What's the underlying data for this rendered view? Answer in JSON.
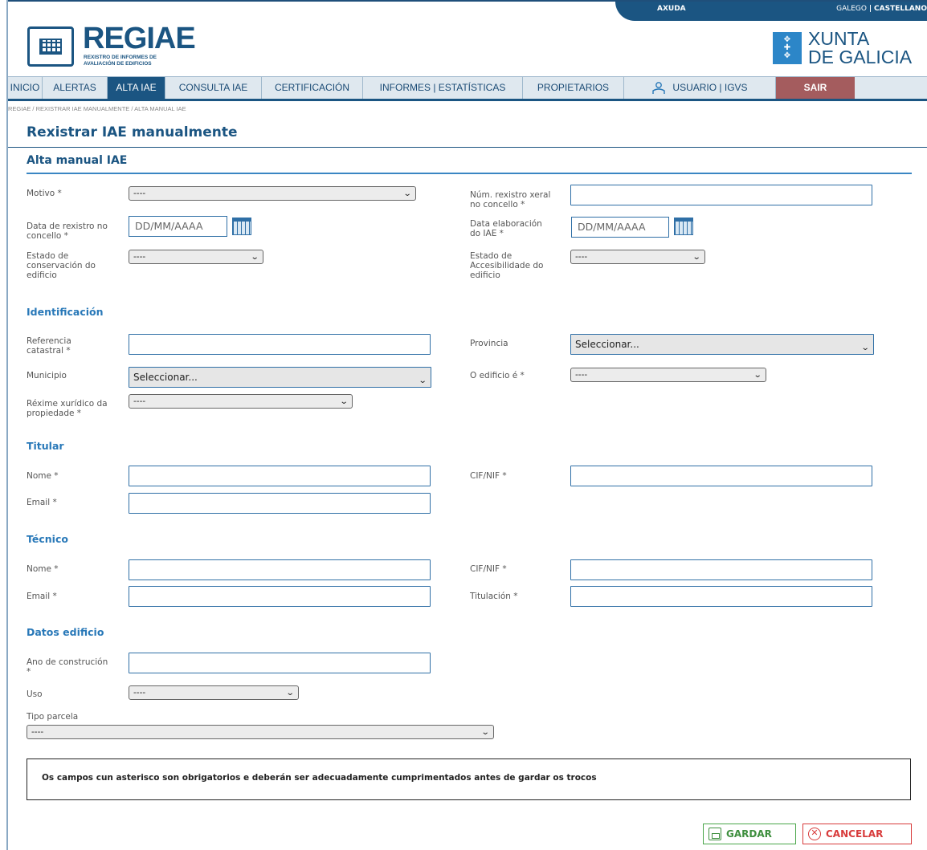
{
  "utility": {
    "help": "AXUDA",
    "lang_gl": "GALEGO",
    "separator": "|",
    "lang_es": "CASTELLANO"
  },
  "brand": {
    "app_title": "REGIAE",
    "app_subtitle_1": "REXISTRO DE INFORMES DE",
    "app_subtitle_2": "AVALIACIÓN DE EDIFICIOS",
    "gov_line1": "XUNTA",
    "gov_line2": "DE GALICIA"
  },
  "nav": {
    "items": [
      "INICIO",
      "ALERTAS",
      "ALTA IAE",
      "CONSULTA IAE",
      "CERTIFICACIÓN",
      "INFORMES | ESTATÍSTICAS",
      "PROPIETARIOS",
      "USUARIO | IGVS",
      "SAIR"
    ],
    "active": "ALTA IAE"
  },
  "breadcrumb": "REGIAE / REXISTRAR IAE MANUALMENTE / ALTA MANUAL IAE",
  "page_title": "Rexistrar IAE manualmente",
  "section_title": "Alta manual IAE",
  "general": {
    "motivo_label": "Motivo *",
    "motivo_value": "----",
    "num_rexistro_label_1": "Núm. rexistro xeral",
    "num_rexistro_label_2": "no concello *",
    "data_rexistro_label_1": "Data de rexistro no",
    "data_rexistro_label_2": "concello *",
    "data_rexistro_placeholder": "DD/MM/AAAA",
    "data_elab_label_1": "Data elaboración",
    "data_elab_label_2": "do IAE *",
    "data_elab_placeholder": "DD/MM/AAAA",
    "estado_cons_label_1": "Estado de",
    "estado_cons_label_2": "conservación do",
    "estado_cons_label_3": "edificio",
    "estado_cons_value": "----",
    "estado_acc_label_1": "Estado de",
    "estado_acc_label_2": "Accesibilidade do",
    "estado_acc_label_3": "edificio",
    "estado_acc_value": "----"
  },
  "identificacion": {
    "title": "Identificación",
    "ref_label_1": "Referencia",
    "ref_label_2": "catastral *",
    "provincia_label": "Provincia",
    "provincia_value": "Seleccionar...",
    "municipio_label": "Municipio",
    "municipio_value": "Seleccionar...",
    "edificio_label": "O edificio é *",
    "edificio_value": "----",
    "rexime_label_1": "Réxime xurídico da",
    "rexime_label_2": "propiedade *",
    "rexime_value": "----"
  },
  "titular": {
    "title": "Titular",
    "nome_label": "Nome *",
    "cif_label": "CIF/NIF *",
    "email_label": "Email *"
  },
  "tecnico": {
    "title": "Técnico",
    "nome_label": "Nome *",
    "cif_label": "CIF/NIF *",
    "email_label": "Email *",
    "titulacion_label": "Titulación *"
  },
  "edificio": {
    "title": "Datos edificio",
    "ano_label_1": "Ano de construción",
    "ano_label_2": "*",
    "uso_label": "Uso",
    "uso_value": "----",
    "parcela_label": "Tipo parcela",
    "parcela_value": "----"
  },
  "notice": "Os campos cun asterisco son obrigatorios e deberán ser adecuadamente cumprimentados antes de gardar os trocos",
  "actions": {
    "save": "GARDAR",
    "cancel": "CANCELAR"
  },
  "colors": {
    "primary": "#1b5582",
    "accent": "#2878b8",
    "exit": "#a45c5e",
    "save": "#3e8f3e",
    "cancel": "#d83b3b"
  },
  "icons": {
    "logo": "grid-logo-icon",
    "gov": "xunta-emblem-icon",
    "user": "user-icon",
    "calendar": "calendar-icon",
    "chevron": "chevron-down-icon",
    "save": "save-icon",
    "cancel": "close-circle-icon"
  }
}
